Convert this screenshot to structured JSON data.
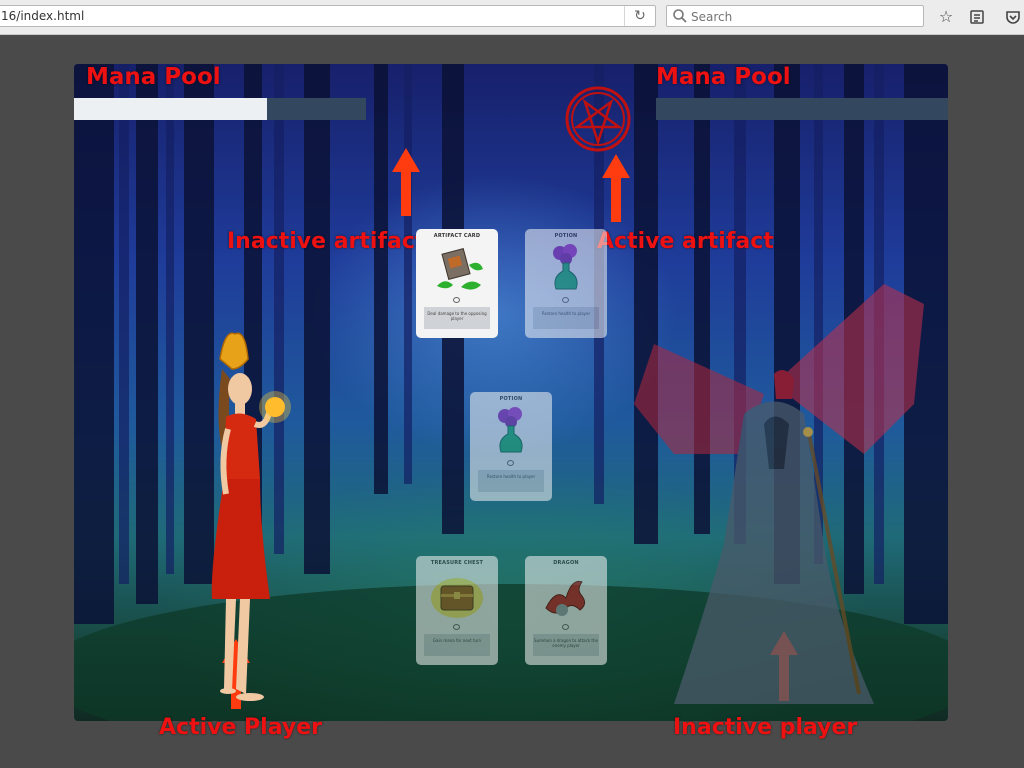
{
  "browser": {
    "url": "16/index.html",
    "search_placeholder": "Search",
    "icons": [
      "reload-icon",
      "search-icon",
      "bookmark-star-icon",
      "reading-list-icon",
      "pocket-icon"
    ]
  },
  "game": {
    "left_mana_label": "Mana Pool",
    "right_mana_label": "Mana Pool",
    "left_mana_fill_fraction": 0.66,
    "right_mana_fill_fraction": 0.0,
    "annotations": {
      "inactive_artifact": "Inactive artifact",
      "active_artifact": "Active artifact",
      "active_player": "Active Player",
      "inactive_player": "Inactive player"
    },
    "cards": [
      {
        "title": "ARTIFACT CARD",
        "art": "cannon",
        "faded": false,
        "desc": "Deal damage to the opposing player"
      },
      {
        "title": "POTION",
        "art": "potion",
        "faded": true,
        "desc": "Restore health to player"
      },
      {
        "title": "POTION",
        "art": "potion",
        "faded": true,
        "desc": "Restore health to player"
      },
      {
        "title": "TREASURE CHEST",
        "art": "chest",
        "faded": true,
        "desc": "Gain mana for next turn"
      },
      {
        "title": "DRAGON",
        "art": "dragon",
        "faded": true,
        "desc": "Summon a dragon to attack the enemy player"
      }
    ],
    "colors": {
      "annotation": "#ee1111",
      "arrow": "#ff3b10",
      "mana_fill": "#edf0f3",
      "mana_empty": "#33475e"
    }
  }
}
